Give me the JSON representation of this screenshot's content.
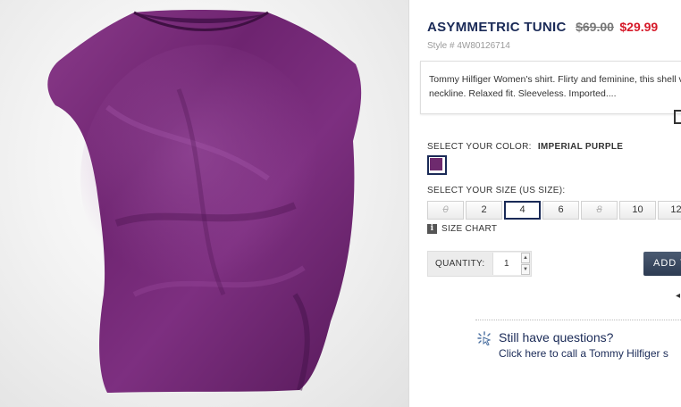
{
  "product": {
    "title": "ASYMMETRIC TUNIC",
    "old_price": "$69.00",
    "new_price": "$29.99",
    "style_number": "Style # 4W80126714",
    "description": "Tommy Hilfiger Women's shirt. Flirty and feminine, this shell v-neckline. Relaxed fit. Sleeveless. Imported...."
  },
  "color": {
    "label": "SELECT YOUR COLOR:",
    "selected": "IMPERIAL PURPLE",
    "swatch_hex": "#6e2a6e"
  },
  "size": {
    "label": "SELECT YOUR SIZE (US SIZE):",
    "options": [
      {
        "label": "0",
        "available": false
      },
      {
        "label": "2",
        "available": true
      },
      {
        "label": "4",
        "available": true,
        "selected": true
      },
      {
        "label": "6",
        "available": true
      },
      {
        "label": "8",
        "available": false
      },
      {
        "label": "10",
        "available": true
      },
      {
        "label": "12",
        "available": true
      }
    ],
    "chart_link": "SIZE CHART",
    "chart_icon": "info-icon"
  },
  "quantity": {
    "label": "QUANTITY:",
    "value": "1"
  },
  "cart": {
    "button_label": "ADD T"
  },
  "help": {
    "heading": "Still have questions?",
    "subtext": "Click here to call a Tommy Hilfiger s"
  },
  "colors": {
    "title": "#1a2a57",
    "sale_price": "#d61a2a",
    "garment": "#6e2a6e"
  }
}
